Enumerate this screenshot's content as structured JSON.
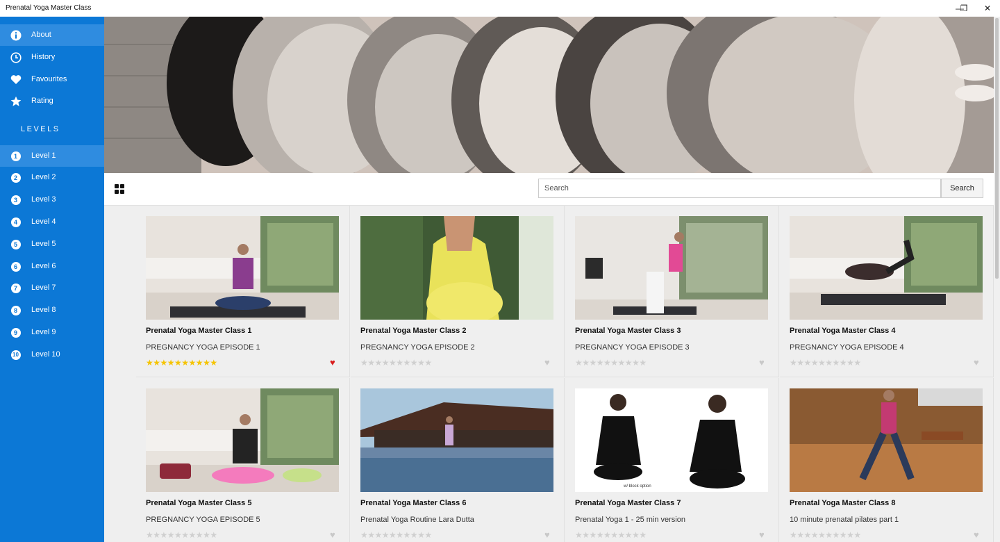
{
  "window": {
    "title": "Prenatal Yoga Master Class",
    "minimize": "—",
    "restore": "❐",
    "close": "✕"
  },
  "sidebar": {
    "items": [
      {
        "label": "About",
        "icon": "info-icon"
      },
      {
        "label": "History",
        "icon": "clock-icon"
      },
      {
        "label": "Favourites",
        "icon": "heart-icon"
      },
      {
        "label": "Rating",
        "icon": "star-icon"
      }
    ],
    "levels_header": "LEVELS",
    "levels": [
      {
        "num": "1",
        "label": "Level 1"
      },
      {
        "num": "2",
        "label": "Level 2"
      },
      {
        "num": "3",
        "label": "Level 3"
      },
      {
        "num": "4",
        "label": "Level 4"
      },
      {
        "num": "5",
        "label": "Level 5"
      },
      {
        "num": "6",
        "label": "Level 6"
      },
      {
        "num": "7",
        "label": "Level 7"
      },
      {
        "num": "8",
        "label": "Level 8"
      },
      {
        "num": "9",
        "label": "Level 9"
      },
      {
        "num": "10",
        "label": "Level 10"
      }
    ],
    "active_level": "Level 1"
  },
  "toolbar": {
    "search_placeholder": "Search",
    "search_button": "Search"
  },
  "rating_symbols": {
    "stars": "★★★★★★★★★★",
    "heart": "♥"
  },
  "colors": {
    "sidebar": "#0c78d6",
    "star_filled": "#f5c400",
    "star_empty": "#cfcfcf",
    "heart_active": "#d81c1c",
    "heart_inactive": "#c8c8c8"
  },
  "cards": [
    {
      "title": "Prenatal Yoga Master Class 1",
      "subtitle": "PREGNANCY YOGA EPISODE 1",
      "rated": true,
      "favourite": true
    },
    {
      "title": "Prenatal Yoga Master Class 2",
      "subtitle": "PREGNANCY YOGA EPISODE 2",
      "rated": false,
      "favourite": false
    },
    {
      "title": "Prenatal Yoga Master Class 3",
      "subtitle": "PREGNANCY YOGA EPISODE 3",
      "rated": false,
      "favourite": false
    },
    {
      "title": "Prenatal Yoga Master Class 4",
      "subtitle": "PREGNANCY YOGA EPISODE 4",
      "rated": false,
      "favourite": false
    },
    {
      "title": "Prenatal Yoga Master Class 5",
      "subtitle": "PREGNANCY YOGA EPISODE 5",
      "rated": false,
      "favourite": false
    },
    {
      "title": "Prenatal Yoga Master Class 6",
      "subtitle": "Prenatal Yoga Routine Lara Dutta",
      "rated": false,
      "favourite": false
    },
    {
      "title": "Prenatal Yoga Master Class 7",
      "subtitle": "Prenatal Yoga 1 - 25 min version",
      "rated": false,
      "favourite": false,
      "thumb_caption": "w/ block option"
    },
    {
      "title": "Prenatal Yoga Master Class 8",
      "subtitle": "10 minute prenatal pilates part 1",
      "rated": false,
      "favourite": false
    }
  ]
}
